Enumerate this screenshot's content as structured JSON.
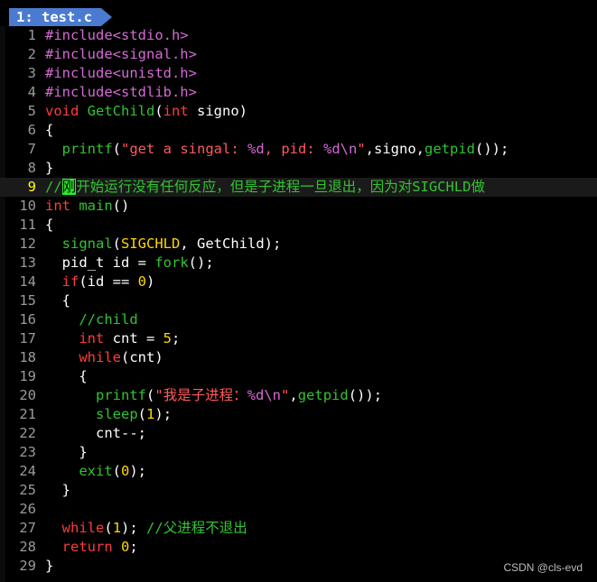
{
  "tab": {
    "label": "1: test.c"
  },
  "lines": [
    {
      "n": "1",
      "segs": [
        {
          "t": "#include<stdio.h>",
          "c": "c-pre"
        }
      ]
    },
    {
      "n": "2",
      "segs": [
        {
          "t": "#include<signal.h>",
          "c": "c-pre"
        }
      ]
    },
    {
      "n": "3",
      "segs": [
        {
          "t": "#include<unistd.h>",
          "c": "c-pre"
        }
      ]
    },
    {
      "n": "4",
      "segs": [
        {
          "t": "#include<stdlib.h>",
          "c": "c-pre"
        }
      ]
    },
    {
      "n": "5",
      "segs": [
        {
          "t": "void",
          "c": "c-type"
        },
        {
          "t": " ",
          "c": "c-def"
        },
        {
          "t": "GetChild",
          "c": "c-fn"
        },
        {
          "t": "(",
          "c": "c-def"
        },
        {
          "t": "int",
          "c": "c-type"
        },
        {
          "t": " signo)",
          "c": "c-def"
        }
      ]
    },
    {
      "n": "6",
      "segs": [
        {
          "t": "{",
          "c": "c-def"
        }
      ]
    },
    {
      "n": "7",
      "segs": [
        {
          "t": "  ",
          "c": "c-def"
        },
        {
          "t": "printf",
          "c": "c-fn"
        },
        {
          "t": "(",
          "c": "c-def"
        },
        {
          "t": "\"get a singal: ",
          "c": "c-str"
        },
        {
          "t": "%d",
          "c": "c-fmt"
        },
        {
          "t": ", pid: ",
          "c": "c-str"
        },
        {
          "t": "%d\\n",
          "c": "c-fmt"
        },
        {
          "t": "\"",
          "c": "c-str"
        },
        {
          "t": ",signo,",
          "c": "c-def"
        },
        {
          "t": "getpid",
          "c": "c-fn"
        },
        {
          "t": "());",
          "c": "c-def"
        }
      ]
    },
    {
      "n": "8",
      "segs": [
        {
          "t": "}",
          "c": "c-def"
        }
      ]
    },
    {
      "n": "9",
      "cur": true,
      "segs": [
        {
          "t": "//",
          "c": "c-cmt"
        },
        {
          "t": "刚",
          "c": "cursor"
        },
        {
          "t": "开始运行没有任何反应，但是子进程一旦退出，因为对SIGCHLD做",
          "c": "c-cmt"
        }
      ]
    },
    {
      "n": "10",
      "segs": [
        {
          "t": "int",
          "c": "c-type"
        },
        {
          "t": " ",
          "c": "c-def"
        },
        {
          "t": "main",
          "c": "c-fn"
        },
        {
          "t": "()",
          "c": "c-def"
        }
      ]
    },
    {
      "n": "11",
      "segs": [
        {
          "t": "{",
          "c": "c-def"
        }
      ]
    },
    {
      "n": "12",
      "segs": [
        {
          "t": "  ",
          "c": "c-def"
        },
        {
          "t": "signal",
          "c": "c-fn"
        },
        {
          "t": "(",
          "c": "c-def"
        },
        {
          "t": "SIGCHLD",
          "c": "c-num"
        },
        {
          "t": ", GetChild);",
          "c": "c-def"
        }
      ]
    },
    {
      "n": "13",
      "segs": [
        {
          "t": "  pid_t id = ",
          "c": "c-def"
        },
        {
          "t": "fork",
          "c": "c-fn"
        },
        {
          "t": "();",
          "c": "c-def"
        }
      ]
    },
    {
      "n": "14",
      "segs": [
        {
          "t": "  ",
          "c": "c-def"
        },
        {
          "t": "if",
          "c": "c-kw"
        },
        {
          "t": "(id == ",
          "c": "c-def"
        },
        {
          "t": "0",
          "c": "c-num"
        },
        {
          "t": ")",
          "c": "c-def"
        }
      ]
    },
    {
      "n": "15",
      "segs": [
        {
          "t": "  {",
          "c": "c-def"
        }
      ]
    },
    {
      "n": "16",
      "segs": [
        {
          "t": "    //child",
          "c": "c-cmt"
        }
      ]
    },
    {
      "n": "17",
      "segs": [
        {
          "t": "    ",
          "c": "c-def"
        },
        {
          "t": "int",
          "c": "c-type"
        },
        {
          "t": " cnt = ",
          "c": "c-def"
        },
        {
          "t": "5",
          "c": "c-num"
        },
        {
          "t": ";",
          "c": "c-def"
        }
      ]
    },
    {
      "n": "18",
      "segs": [
        {
          "t": "    ",
          "c": "c-def"
        },
        {
          "t": "while",
          "c": "c-kw"
        },
        {
          "t": "(cnt)",
          "c": "c-def"
        }
      ]
    },
    {
      "n": "19",
      "segs": [
        {
          "t": "    {",
          "c": "c-def"
        }
      ]
    },
    {
      "n": "20",
      "segs": [
        {
          "t": "      ",
          "c": "c-def"
        },
        {
          "t": "printf",
          "c": "c-fn"
        },
        {
          "t": "(",
          "c": "c-def"
        },
        {
          "t": "\"我是子进程：",
          "c": "c-str"
        },
        {
          "t": "%d\\n",
          "c": "c-fmt"
        },
        {
          "t": "\"",
          "c": "c-str"
        },
        {
          "t": ",",
          "c": "c-def"
        },
        {
          "t": "getpid",
          "c": "c-fn"
        },
        {
          "t": "());",
          "c": "c-def"
        }
      ]
    },
    {
      "n": "21",
      "segs": [
        {
          "t": "      ",
          "c": "c-def"
        },
        {
          "t": "sleep",
          "c": "c-fn"
        },
        {
          "t": "(",
          "c": "c-def"
        },
        {
          "t": "1",
          "c": "c-num"
        },
        {
          "t": ");",
          "c": "c-def"
        }
      ]
    },
    {
      "n": "22",
      "segs": [
        {
          "t": "      cnt--;",
          "c": "c-def"
        }
      ]
    },
    {
      "n": "23",
      "segs": [
        {
          "t": "    }",
          "c": "c-def"
        }
      ]
    },
    {
      "n": "24",
      "segs": [
        {
          "t": "    ",
          "c": "c-def"
        },
        {
          "t": "exit",
          "c": "c-fn"
        },
        {
          "t": "(",
          "c": "c-def"
        },
        {
          "t": "0",
          "c": "c-num"
        },
        {
          "t": ");",
          "c": "c-def"
        }
      ]
    },
    {
      "n": "25",
      "segs": [
        {
          "t": "  }",
          "c": "c-def"
        }
      ]
    },
    {
      "n": "26",
      "segs": []
    },
    {
      "n": "27",
      "segs": [
        {
          "t": "  ",
          "c": "c-def"
        },
        {
          "t": "while",
          "c": "c-kw"
        },
        {
          "t": "(",
          "c": "c-def"
        },
        {
          "t": "1",
          "c": "c-num"
        },
        {
          "t": "); ",
          "c": "c-def"
        },
        {
          "t": "//父进程不退出",
          "c": "c-cmt"
        }
      ]
    },
    {
      "n": "28",
      "segs": [
        {
          "t": "  ",
          "c": "c-def"
        },
        {
          "t": "return",
          "c": "c-kw"
        },
        {
          "t": " ",
          "c": "c-def"
        },
        {
          "t": "0",
          "c": "c-num"
        },
        {
          "t": ";",
          "c": "c-def"
        }
      ]
    },
    {
      "n": "29",
      "segs": [
        {
          "t": "}",
          "c": "c-def"
        }
      ]
    }
  ],
  "watermark": "CSDN @cls-evd"
}
